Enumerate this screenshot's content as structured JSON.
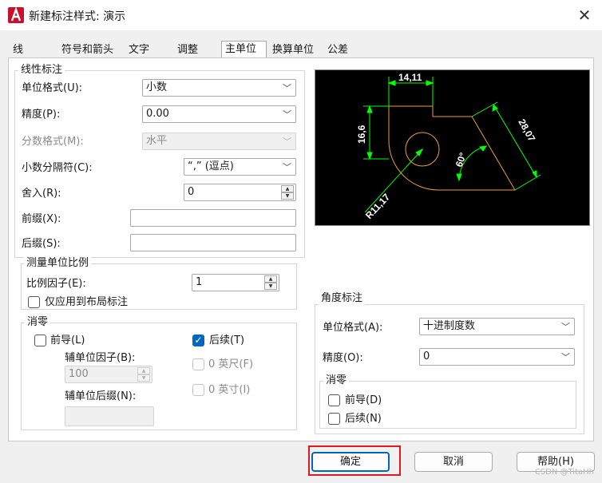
{
  "window": {
    "title": "新建标注样式: 演示",
    "close": "✕"
  },
  "tabs": [
    "线",
    "符号和箭头",
    "文字",
    "调整",
    "主单位",
    "换算单位",
    "公差"
  ],
  "linear": {
    "title": "线性标注",
    "unit_format_label": "单位格式(U):",
    "unit_format_value": "小数",
    "precision_label": "精度(P):",
    "precision_value": "0.00",
    "fraction_format_label": "分数格式(M):",
    "fraction_format_value": "水平",
    "decimal_sep_label": "小数分隔符(C):",
    "decimal_sep_value": "“,” (逗点)",
    "round_label": "舍入(R):",
    "round_value": "0",
    "prefix_label": "前缀(X):",
    "prefix_value": "",
    "suffix_label": "后缀(S):",
    "suffix_value": ""
  },
  "scale": {
    "title": "测量单位比例",
    "factor_label": "比例因子(E):",
    "factor_value": "1",
    "layout_only_label": "仅应用到布局标注"
  },
  "zero_linear": {
    "title": "消零",
    "leading_label": "前导(L)",
    "trailing_label": "后续(T)",
    "sub_factor_label": "辅单位因子(B):",
    "sub_factor_value": "100",
    "sub_suffix_label": "辅单位后缀(N):",
    "sub_suffix_value": "",
    "feet_label": "0 英尺(F)",
    "inch_label": "0 英寸(I)"
  },
  "angular": {
    "title": "角度标注",
    "unit_format_label": "单位格式(A):",
    "unit_format_value": "十进制度数",
    "precision_label": "精度(O):",
    "precision_value": "0",
    "zero_title": "消零",
    "leading_label": "前导(D)",
    "trailing_label": "后续(N)"
  },
  "preview": {
    "dim_top": "14,11",
    "dim_left": "16,6",
    "dim_slant": "28,07",
    "dim_angle": "60°",
    "dim_radius": "R11,17"
  },
  "buttons": {
    "ok": "确定",
    "cancel": "取消",
    "help": "帮助(H)"
  },
  "watermark": "CSDN @TitaHh",
  "colors": {
    "accent": "#0067c0",
    "highlight": "#e1191e",
    "preview_green": "#00ff00",
    "preview_orange": "#e8a030"
  }
}
